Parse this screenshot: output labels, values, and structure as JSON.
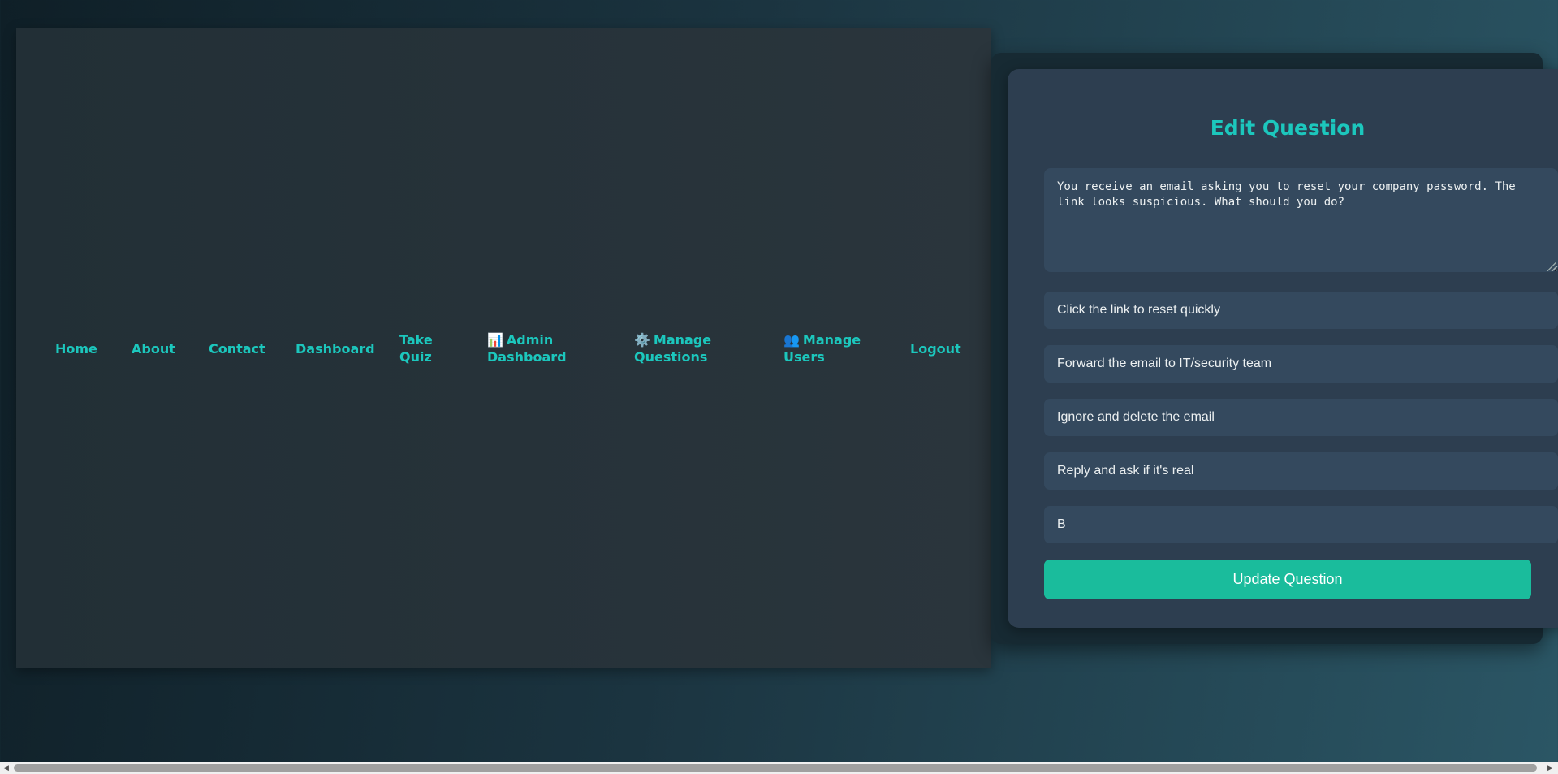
{
  "nav": {
    "home": "Home",
    "about": "About",
    "contact": "Contact",
    "dashboard": "Dashboard",
    "take_quiz_line1": "Take",
    "take_quiz_line2": "Quiz",
    "admin_emoji": "📊",
    "admin_line1": "Admin",
    "admin_line2": "Dashboard",
    "manage_questions_emoji": "⚙️",
    "manage_questions_line1": "Manage",
    "manage_questions_line2": "Questions",
    "manage_users_emoji": "👥",
    "manage_users_line1": "Manage",
    "manage_users_line2": "Users",
    "logout": "Logout"
  },
  "form": {
    "title": "Edit Question",
    "question_text": "You receive an email asking you to reset your company password. The link looks suspicious. What should you do?",
    "option_a": "Click the link to reset quickly",
    "option_b": "Forward the email to IT/security team",
    "option_c": "Ignore and delete the email",
    "option_d": "Reply and ask if it's real",
    "correct_answer": "B",
    "submit_label": "Update Question"
  },
  "colors": {
    "accent": "#1cc7bd",
    "button": "#1abc9c",
    "input_bg": "#34495e",
    "card_bg": "#2d3e50"
  }
}
